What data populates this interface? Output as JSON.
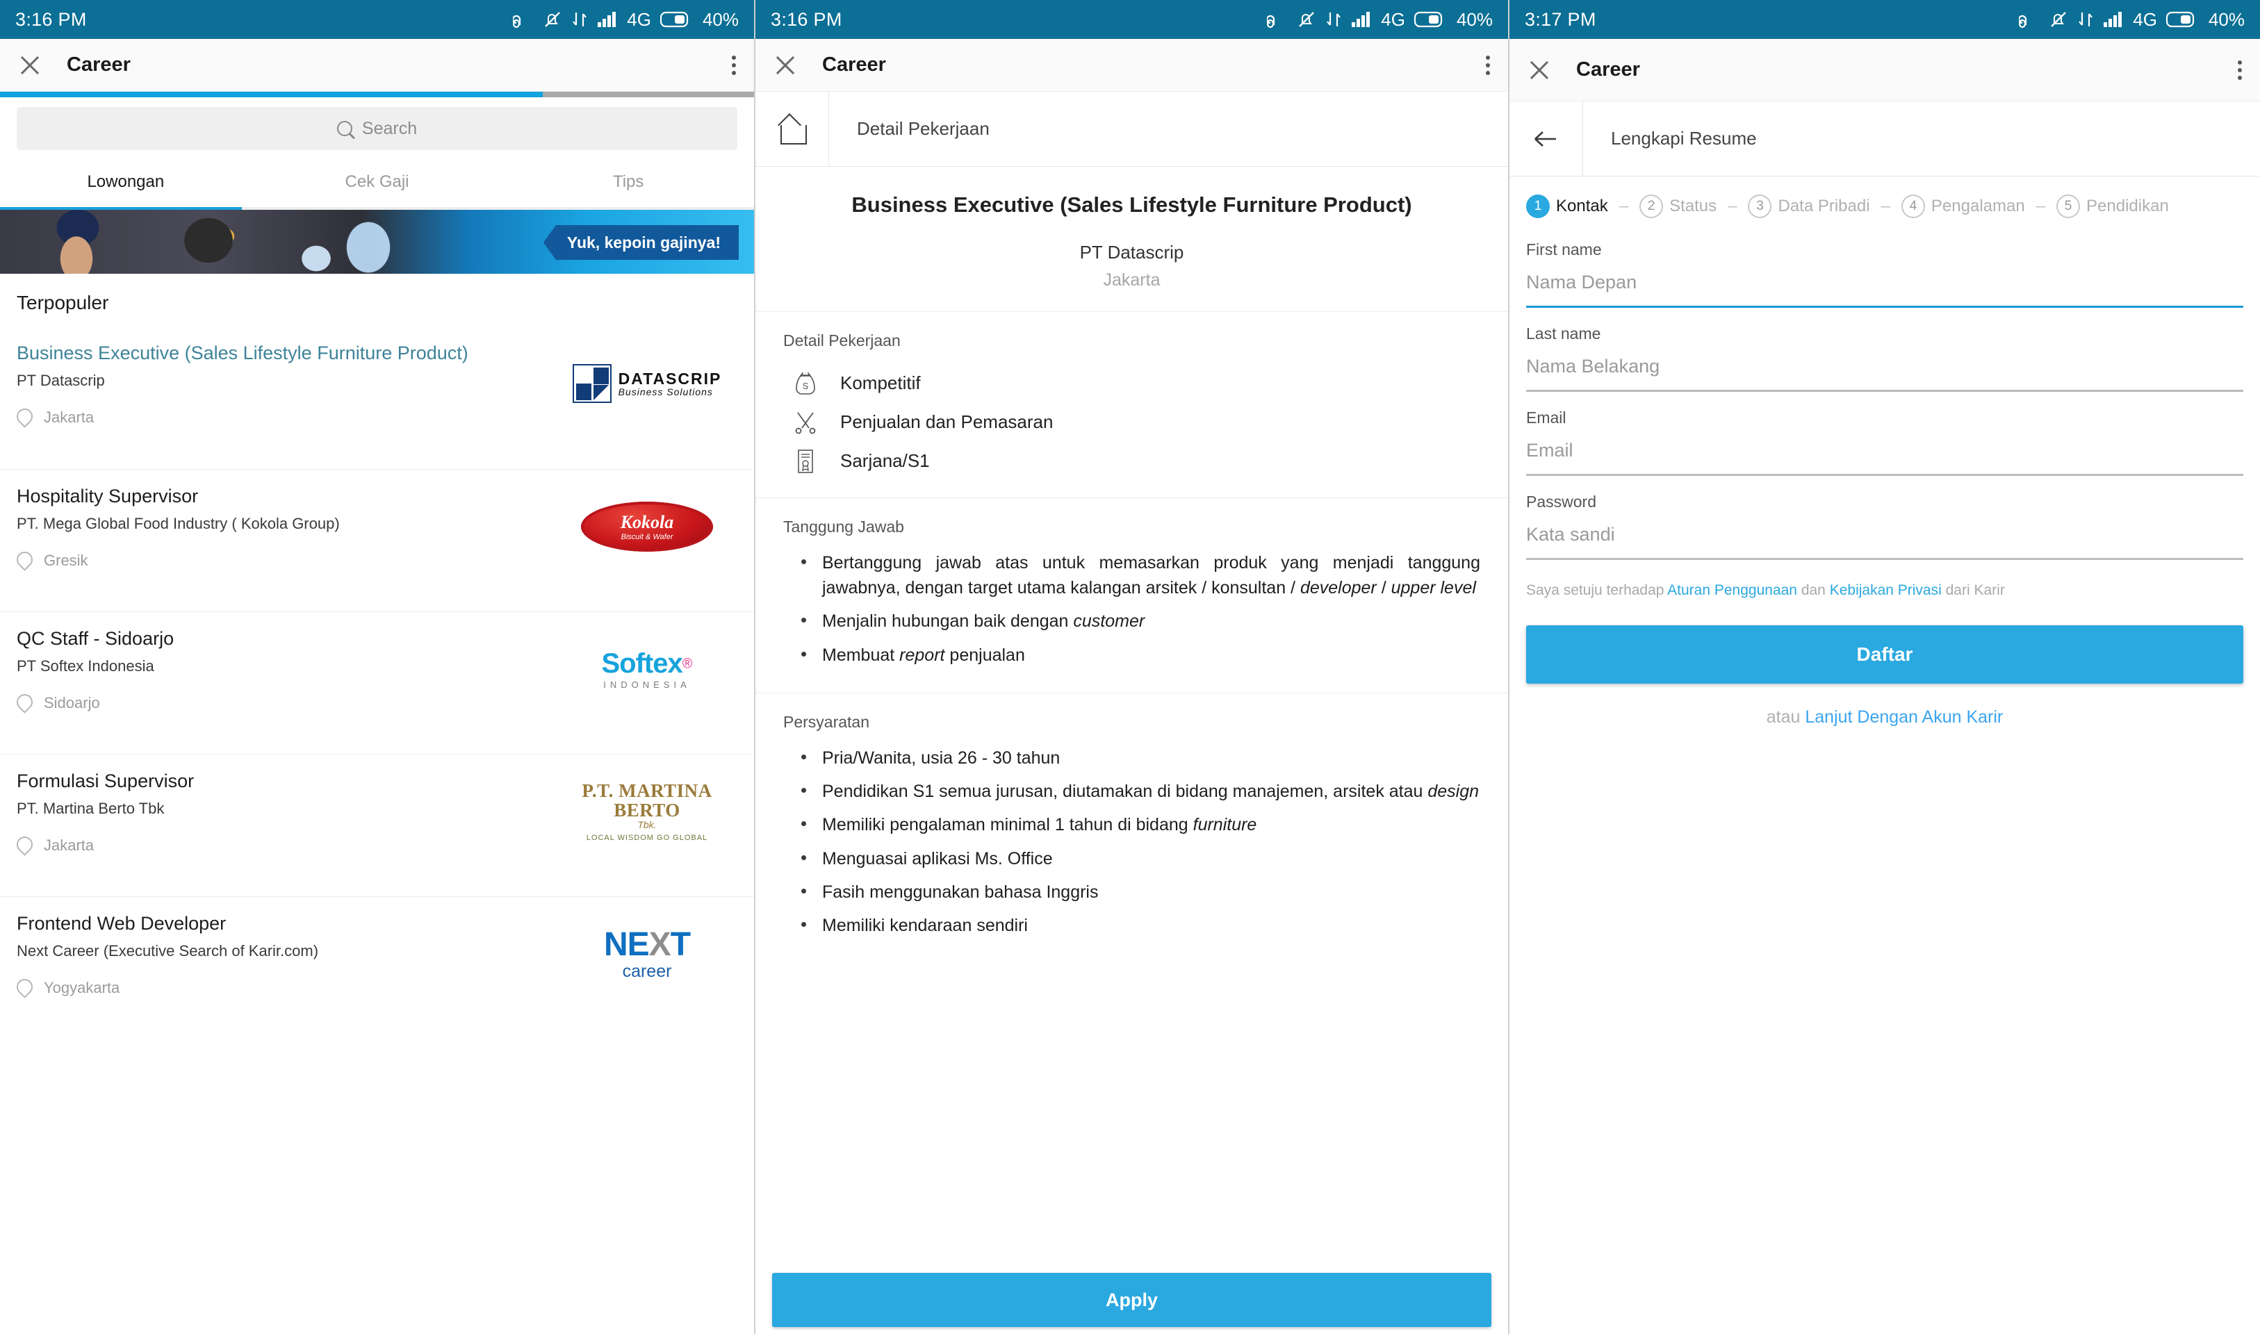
{
  "statusbars": [
    {
      "time": "3:16 PM",
      "network": "4G",
      "battery": "40%"
    },
    {
      "time": "3:16 PM",
      "network": "4G",
      "battery": "40%"
    },
    {
      "time": "3:17 PM",
      "network": "4G",
      "battery": "40%"
    }
  ],
  "appbar": {
    "title": "Career"
  },
  "panel1": {
    "search": {
      "placeholder": "Search"
    },
    "tabs": [
      {
        "label": "Lowongan",
        "active": true
      },
      {
        "label": "Cek Gaji",
        "active": false
      },
      {
        "label": "Tips",
        "active": false
      }
    ],
    "banner": {
      "tagline": "Yuk, kepoin gajinya!"
    },
    "section_title": "Terpopuler",
    "jobs": [
      {
        "title": "Business Executive (Sales Lifestyle Furniture Product)",
        "company": "PT Datascrip",
        "location": "Jakarta",
        "logo": "datascrip"
      },
      {
        "title": "Hospitality Supervisor",
        "company": "PT. Mega Global Food Industry ( Kokola Group)",
        "location": "Gresik",
        "logo": "kokola"
      },
      {
        "title": "QC Staff - Sidoarjo",
        "company": "PT Softex Indonesia",
        "location": "Sidoarjo",
        "logo": "softex"
      },
      {
        "title": "Formulasi Supervisor",
        "company": "PT. Martina Berto Tbk",
        "location": "Jakarta",
        "logo": "martina"
      },
      {
        "title": "Frontend Web Developer",
        "company": "Next Career (Executive Search of Karir.com)",
        "location": "Yogyakarta",
        "logo": "next"
      }
    ],
    "logos": {
      "datascrip": {
        "name": "DATASCRIP",
        "tagline": "Business Solutions"
      },
      "kokola": {
        "name": "Kokola",
        "tagline": "Biscuit & Wafer"
      },
      "softex": {
        "name": "Softex",
        "tagline": "INDONESIA"
      },
      "martina": {
        "name": "P.T. MARTINA BERTO",
        "suffix": "Tbk.",
        "tagline": "LOCAL WISDOM GO GLOBAL"
      },
      "next": {
        "name_a": "NE",
        "name_x": "X",
        "name_b": "T",
        "tagline": "career"
      }
    }
  },
  "panel2": {
    "breadcrumb": "Detail Pekerjaan",
    "job_title": "Business Executive (Sales Lifestyle Furniture Product)",
    "company": "PT Datascrip",
    "location": "Jakarta",
    "detail_heading": "Detail Pekerjaan",
    "details": [
      {
        "icon": "money-bag-icon",
        "label": "Kompetitif"
      },
      {
        "icon": "tools-icon",
        "label": "Penjualan dan Pemasaran"
      },
      {
        "icon": "certificate-icon",
        "label": "Sarjana/S1"
      }
    ],
    "responsibility_heading": "Tanggung Jawab",
    "responsibilities": [
      "Bertanggung jawab atas untuk memasarkan produk yang menjadi tanggung jawabnya, dengan target utama kalangan arsitek / konsultan / <i>developer</i> / <i>upper level</i>",
      "Menjalin hubungan baik dengan <i>customer</i>",
      "Membuat <i>report</i> penjualan"
    ],
    "requirement_heading": "Persyaratan",
    "requirements": [
      "Pria/Wanita, usia 26 - 30 tahun",
      "Pendidikan S1 semua jurusan, diutamakan di bidang manajemen, arsitek atau <i>design</i>",
      "Memiliki pengalaman minimal 1 tahun di bidang <i>furniture</i>",
      "Menguasai aplikasi Ms. Office",
      "Fasih menggunakan bahasa Inggris",
      "Memiliki kendaraan sendiri"
    ],
    "apply_label": "Apply"
  },
  "panel3": {
    "breadcrumb": "Lengkapi Resume",
    "steps": [
      {
        "num": "1",
        "label": "Kontak",
        "active": true
      },
      {
        "num": "2",
        "label": "Status",
        "active": false
      },
      {
        "num": "3",
        "label": "Data Pribadi",
        "active": false
      },
      {
        "num": "4",
        "label": "Pengalaman",
        "active": false
      },
      {
        "num": "5",
        "label": "Pendidikan",
        "active": false
      }
    ],
    "fields": [
      {
        "label": "First name",
        "placeholder": "Nama Depan",
        "focused": true
      },
      {
        "label": "Last name",
        "placeholder": "Nama Belakang",
        "focused": false
      },
      {
        "label": "Email",
        "placeholder": "Email",
        "focused": false
      },
      {
        "label": "Password",
        "placeholder": "Kata sandi",
        "focused": false
      }
    ],
    "terms": {
      "pre": "Saya setuju terhadap ",
      "link1": "Aturan Penggunaan",
      "mid": " dan ",
      "link2": "Kebijakan Privasi",
      "post": " dari Karir"
    },
    "submit_label": "Daftar",
    "alt": {
      "pre": "atau ",
      "link": "Lanjut Dengan Akun Karir"
    }
  },
  "colors": {
    "status_bar": "#0c6f95",
    "accent": "#2aa8e0",
    "progress": "#0fa3e0",
    "link": "#3aa5ef",
    "job_link": "#3d8398"
  }
}
